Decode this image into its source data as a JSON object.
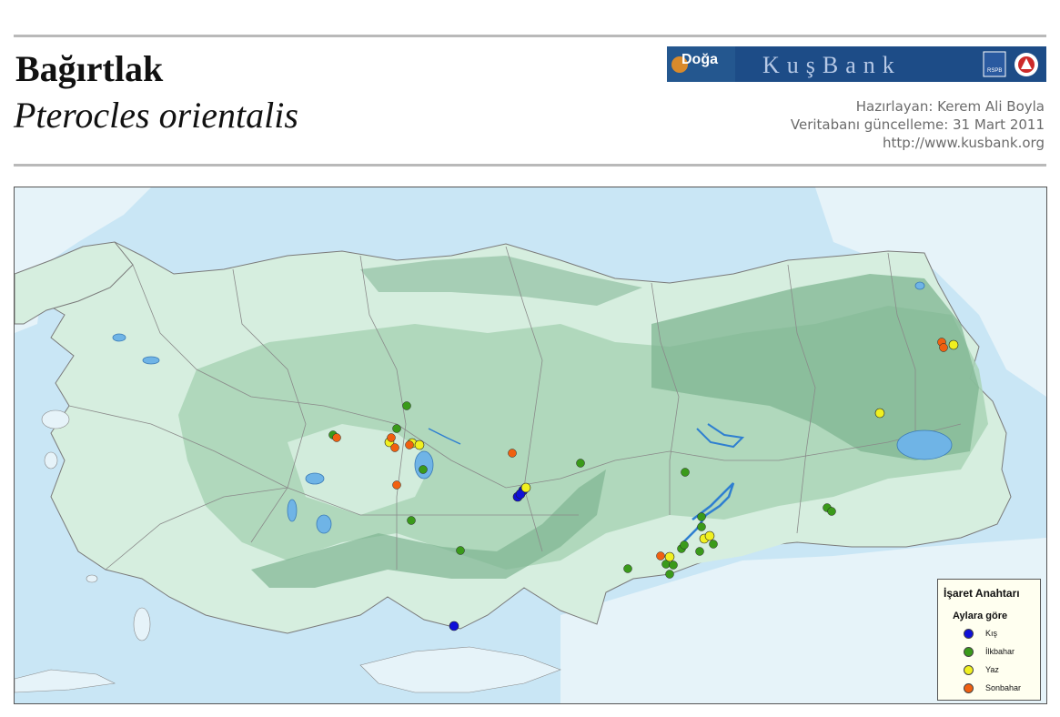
{
  "header": {
    "common_name": "Bağırtlak",
    "scientific_name": "Pterocles orientalis",
    "prepared_by": "Hazırlayan: Kerem Ali Boyla",
    "db_update": "Veritabanı güncelleme: 31 Mart 2011",
    "url": "http://www.kusbank.org"
  },
  "banner": {
    "doga_logo_text": "Doğa",
    "kusbank_logo_text": "KuşBank",
    "rspb_logo_text": "RSPB"
  },
  "legend": {
    "title": "İşaret Anahtarı",
    "subtitle": "Aylara göre",
    "items": [
      {
        "label": "Kış",
        "color": "#1010d8"
      },
      {
        "label": "İlkbahar",
        "color": "#3a9a1a"
      },
      {
        "label": "Yaz",
        "color": "#f0f020"
      },
      {
        "label": "Sonbahar",
        "color": "#f06010"
      }
    ]
  },
  "colors": {
    "sea": "#c9e6f5",
    "land_outside": "#e6f3f9",
    "lowland": "#d6eedf",
    "upland": "#a9d3b6",
    "mountain": "#7fb592",
    "lake": "#6fb4e6",
    "border": "#7a7a7a"
  }
}
